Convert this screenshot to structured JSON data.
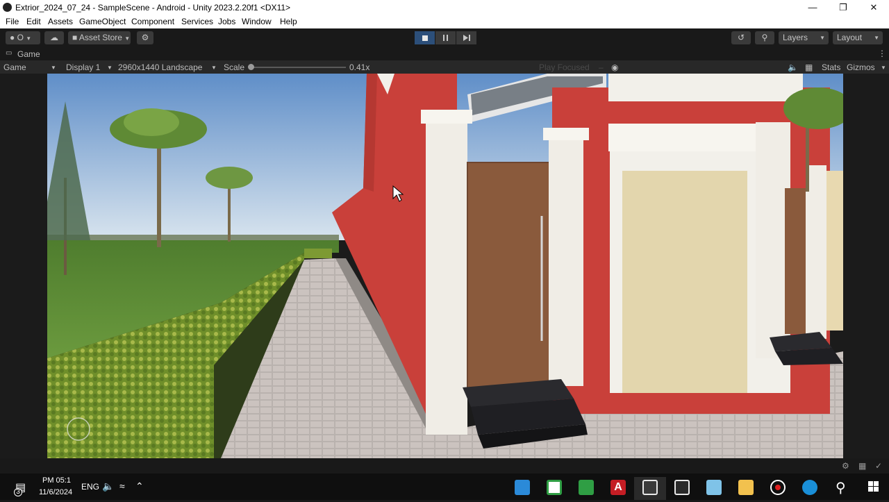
{
  "titlebar": {
    "title": "Extrior_2024_07_24 - SampleScene - Android - Unity 2023.2.20f1 <DX11>",
    "minimize_icon": "minimize-icon",
    "maximize_icon": "restore-icon",
    "close_icon": "close-icon"
  },
  "menubar": {
    "items": [
      "File",
      "Edit",
      "Assets",
      "GameObject",
      "Component",
      "Services",
      "Jobs",
      "Window",
      "Help"
    ]
  },
  "toolbar": {
    "account_label": "O",
    "asset_store_label": "Asset Store",
    "layers_label": "Layers",
    "layout_label": "Layout"
  },
  "tab": {
    "label": "Game"
  },
  "viewbar": {
    "mode": "Game",
    "display": "Display 1",
    "resolution": "2960x1440 Landscape",
    "scale_label": "Scale",
    "scale_value": "0.41x",
    "play_focused": "Play Focused",
    "stats": "Stats",
    "gizmos": "Gizmos"
  },
  "taskbar": {
    "time": "PM 05:1",
    "date": "11/6/2024",
    "language": "ENG",
    "notification_count": "3",
    "apps": [
      "photos-icon",
      "camtasia-icon",
      "camtasia-recorder-icon",
      "autocad-icon",
      "unity-hub-icon",
      "unity-icon",
      "notepad-icon",
      "file-explorer-icon",
      "record-icon",
      "edge-icon",
      "search-icon",
      "windows-start-icon"
    ]
  },
  "colors": {
    "unity_dark": "#191919",
    "wall_red": "#c9403a",
    "trim_white": "#f2f0ea",
    "door_brown": "#8a5a3c",
    "sky_blue": "#8db0d8",
    "grass_green": "#5d8b3a"
  }
}
